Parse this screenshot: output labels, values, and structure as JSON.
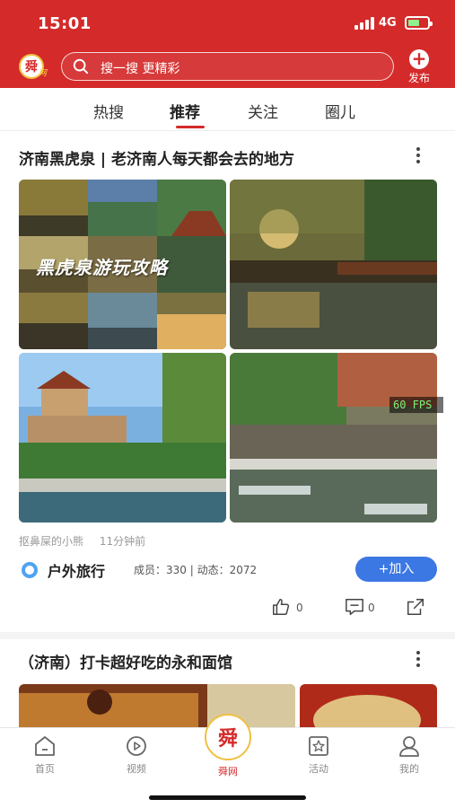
{
  "status_bar": {
    "time": "15:01",
    "network": "4G",
    "icons": [
      "signal-icon",
      "battery-charging-icon"
    ]
  },
  "header": {
    "logo_text": "舜",
    "logo_sub": "网",
    "search_placeholder": "搜一搜 更精彩",
    "publish_label": "发布",
    "accent_color": "#d42a2a"
  },
  "tabs": [
    {
      "label": "热搜"
    },
    {
      "label": "推荐",
      "active": true
    },
    {
      "label": "关注"
    },
    {
      "label": "圈儿"
    }
  ],
  "posts": [
    {
      "title": "济南黑虎泉 | 老济南人每天都会去的地方",
      "image_overlay_text": "黑虎泉游玩攻略",
      "fps_badge": "60 FPS",
      "author": "抠鼻屎的小熊",
      "time_ago": "11分钟前",
      "circle": {
        "name": "户外旅行",
        "stats": "成员：330 | 动态：2072",
        "join_label": "+加入"
      },
      "likes": "0",
      "comments": "0"
    },
    {
      "title": "（济南）打卡超好吃的永和面馆"
    }
  ],
  "bottom_nav": [
    {
      "label": "首页",
      "icon": "home-icon"
    },
    {
      "label": "视频",
      "icon": "video-icon"
    },
    {
      "label": "舜网",
      "icon": "logo-icon",
      "center": true
    },
    {
      "label": "活动",
      "icon": "star-box-icon"
    },
    {
      "label": "我的",
      "icon": "profile-icon"
    }
  ]
}
